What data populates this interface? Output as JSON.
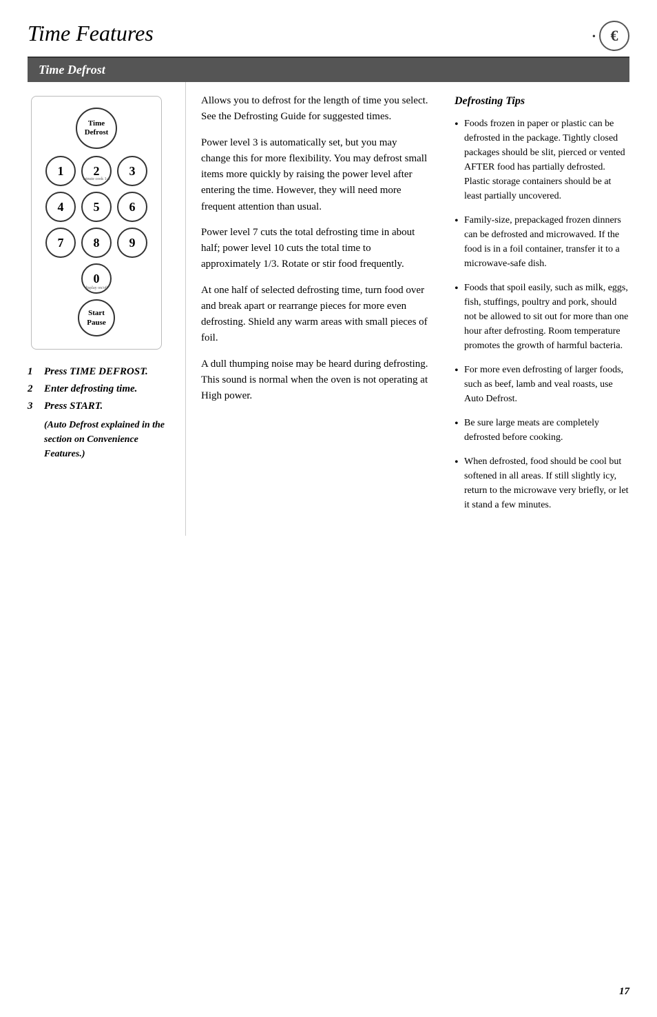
{
  "header": {
    "title": "Time Features",
    "icon_symbol": "€"
  },
  "section": {
    "title": "Time Defrost"
  },
  "keypad": {
    "time_defrost_label": "Time\nDefrost",
    "keys": [
      {
        "label": "1",
        "sub": ""
      },
      {
        "label": "2",
        "sub": "minute cook 1-6"
      },
      {
        "label": "3",
        "sub": ""
      },
      {
        "label": "4",
        "sub": ""
      },
      {
        "label": "5",
        "sub": ""
      },
      {
        "label": "6",
        "sub": ""
      },
      {
        "label": "7",
        "sub": ""
      },
      {
        "label": "8",
        "sub": ""
      },
      {
        "label": "9",
        "sub": ""
      },
      {
        "label": "0",
        "sub": "display on/off"
      }
    ],
    "start_pause_label": "Start\nPause"
  },
  "steps": [
    {
      "number": "1",
      "label": "Press TIME DEFROST."
    },
    {
      "number": "2",
      "label": "Enter defrosting time."
    },
    {
      "number": "3",
      "label": "Press START."
    }
  ],
  "step_note": "(Auto Defrost explained in the section on Convenience Features.)",
  "middle": {
    "paragraphs": [
      "Allows you to defrost for the length of time you select. See the Defrosting Guide for suggested times.",
      "Power level 3 is automatically set, but you may change this for more flexibility. You may defrost small items more quickly by raising the power level after entering the time. However, they will need more frequent attention than usual.",
      "Power level 7 cuts the total defrosting time in about half; power level 10 cuts the total time to approximately 1/3. Rotate or stir food frequently.",
      "At one half of selected defrosting time, turn food over and break apart or rearrange pieces for more even defrosting. Shield any warm areas with small pieces of foil.",
      "A dull thumping noise may be heard during defrosting. This sound is normal when the oven is not operating at High power."
    ]
  },
  "tips": {
    "title": "Defrosting Tips",
    "items": [
      "Foods frozen in paper or plastic can be defrosted in the package. Tightly closed packages should be slit, pierced or vented AFTER food has partially defrosted. Plastic storage containers should be at least partially uncovered.",
      "Family-size, prepackaged frozen dinners can be defrosted and microwaved. If the food is in a foil container, transfer it to a microwave-safe dish.",
      "Foods that spoil easily, such as milk, eggs, fish, stuffings, poultry and pork, should not be allowed to sit out for more than one hour after defrosting. Room temperature promotes the growth of harmful bacteria.",
      "For more even defrosting of larger foods, such as beef, lamb and veal roasts, use Auto Defrost.",
      "Be sure large meats are completely defrosted before cooking.",
      "When defrosted, food should be cool but softened in all areas. If still slightly icy, return to the microwave very briefly, or let it stand a few minutes."
    ]
  },
  "page_number": "17"
}
